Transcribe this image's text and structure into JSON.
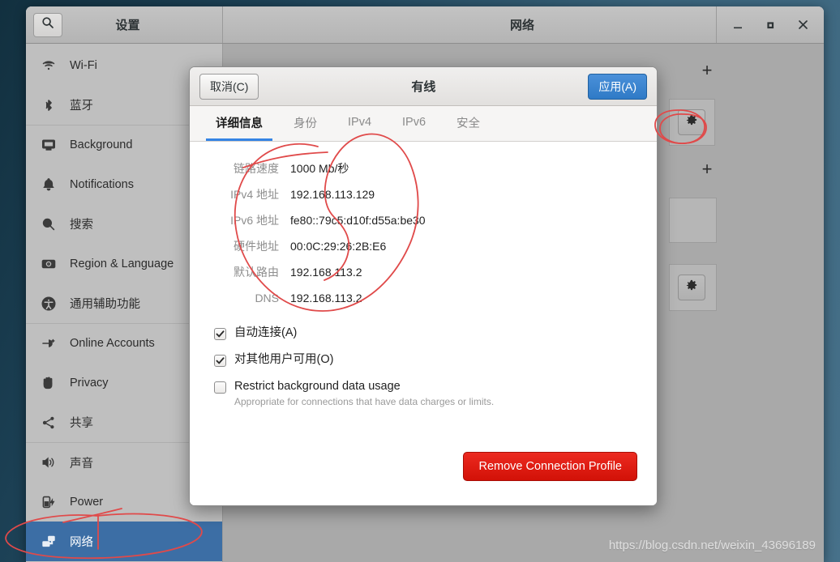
{
  "window": {
    "left_title": "设置",
    "right_title": "网络",
    "search_icon": "search-icon",
    "controls": [
      {
        "name": "minimize",
        "glyph": "minimize-icon"
      },
      {
        "name": "maximize",
        "glyph": "maximize-icon"
      },
      {
        "name": "close",
        "glyph": "close-icon"
      }
    ]
  },
  "sidebar": {
    "items": [
      {
        "label": "Wi-Fi",
        "icon": "wifi-icon",
        "selected": false,
        "separator": false
      },
      {
        "label": "蓝牙",
        "icon": "bluetooth-icon",
        "selected": false,
        "separator": false
      },
      {
        "label": "Background",
        "icon": "monitor-icon",
        "selected": false,
        "separator": true
      },
      {
        "label": "Notifications",
        "icon": "bell-icon",
        "selected": false,
        "separator": false
      },
      {
        "label": "搜索",
        "icon": "search-icon",
        "selected": false,
        "separator": false
      },
      {
        "label": "Region & Language",
        "icon": "region-icon",
        "selected": false,
        "separator": false
      },
      {
        "label": "通用辅助功能",
        "icon": "accessibility-icon",
        "selected": false,
        "separator": false
      },
      {
        "label": "Online Accounts",
        "icon": "online-accounts-icon",
        "selected": false,
        "separator": true
      },
      {
        "label": "Privacy",
        "icon": "hand-icon",
        "selected": false,
        "separator": false
      },
      {
        "label": "共享",
        "icon": "share-icon",
        "selected": false,
        "separator": false
      },
      {
        "label": "声音",
        "icon": "sound-icon",
        "selected": false,
        "separator": true
      },
      {
        "label": "Power",
        "icon": "battery-icon",
        "selected": false,
        "separator": false
      },
      {
        "label": "网络",
        "icon": "network-icon",
        "selected": true,
        "separator": false
      }
    ]
  },
  "content": {
    "add_buttons": [
      "+",
      "+"
    ],
    "gear_icon": "gear-icon",
    "watermark": "https://blog.csdn.net/weixin_43696189"
  },
  "dialog": {
    "cancel_label": "取消(C)",
    "title": "有线",
    "apply_label": "应用(A)",
    "tabs": [
      {
        "label": "详细信息",
        "active": true
      },
      {
        "label": "身份",
        "active": false
      },
      {
        "label": "IPv4",
        "active": false
      },
      {
        "label": "IPv6",
        "active": false
      },
      {
        "label": "安全",
        "active": false
      }
    ],
    "details": [
      {
        "label": "链路速度",
        "value": "1000 Mb/秒"
      },
      {
        "label": "IPv4 地址",
        "value": "192.168.113.129"
      },
      {
        "label": "IPv6 地址",
        "value": "fe80::79c5:d10f:d55a:be30"
      },
      {
        "label": "硬件地址",
        "value": "00:0C:29:26:2B:E6"
      },
      {
        "label": "默认路由",
        "value": "192.168.113.2"
      },
      {
        "label": "DNS",
        "value": "192.168.113.2"
      }
    ],
    "checkboxes": [
      {
        "label": "自动连接(A)",
        "checked": true,
        "sub": ""
      },
      {
        "label": "对其他用户可用(O)",
        "checked": true,
        "sub": ""
      },
      {
        "label": "Restrict background data usage",
        "checked": false,
        "sub": "Appropriate for connections that have data charges or limits."
      }
    ],
    "remove_label": "Remove Connection Profile",
    "accent_color": "#3584e4",
    "danger_color": "#d21107"
  },
  "annotations": {
    "ink_color": "#e04a4a"
  }
}
